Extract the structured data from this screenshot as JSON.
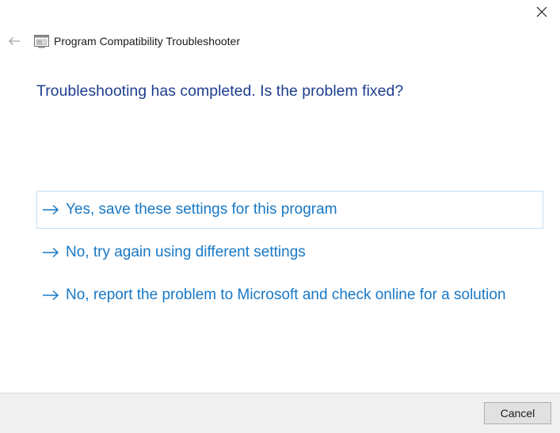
{
  "window": {
    "title": "Program Compatibility Troubleshooter",
    "close_icon": "close-icon",
    "back_icon": "back-arrow-icon",
    "app_icon": "troubleshooter-app-icon"
  },
  "main": {
    "heading": "Troubleshooting has completed.  Is the problem fixed?",
    "options": [
      {
        "label": "Yes, save these settings for this program",
        "icon": "arrow-right-icon",
        "focused": true
      },
      {
        "label": "No, try again using different settings",
        "icon": "arrow-right-icon",
        "focused": false
      },
      {
        "label": "No, report the problem to Microsoft and check online for a solution",
        "icon": "arrow-right-icon",
        "focused": false
      }
    ]
  },
  "footer": {
    "cancel_label": "Cancel"
  },
  "colors": {
    "heading": "#1e3f8f",
    "link": "#1878c5",
    "focus_border": "#c6dcef",
    "footer_bg": "#f0f0f0"
  }
}
